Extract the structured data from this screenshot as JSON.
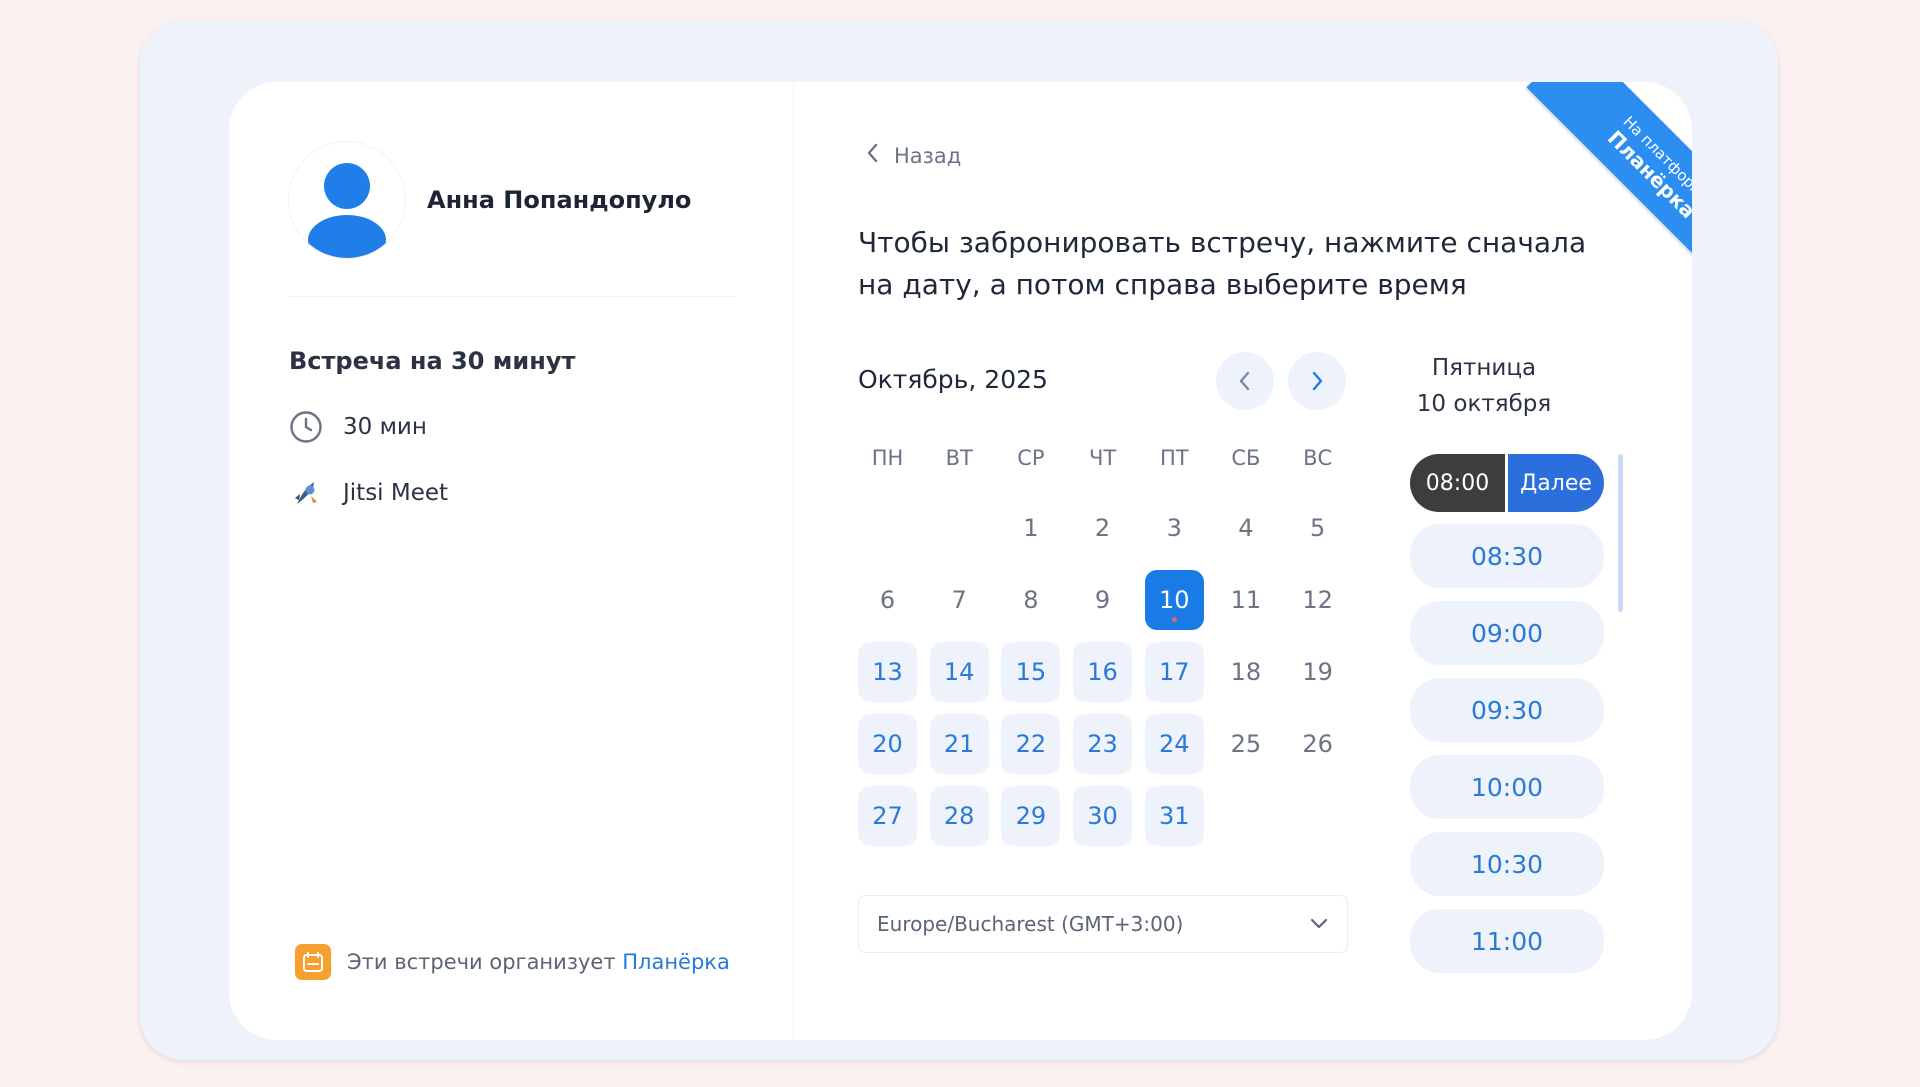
{
  "profile": {
    "name": "Анна Попандопуло"
  },
  "event": {
    "title": "Встреча на 30 минут",
    "duration": "30 мин",
    "location": "Jitsi Meet"
  },
  "organizer": {
    "text": "Эти встречи организует",
    "link": "Планёрка"
  },
  "booking": {
    "back_label": "Назад",
    "instruction": "Чтобы забронировать встречу, нажмите сначала на дату, а потом справа выберите время"
  },
  "calendar": {
    "month_label": "Октябрь, 2025",
    "weekdays": [
      "ПН",
      "ВТ",
      "СР",
      "ЧТ",
      "ПТ",
      "СБ",
      "ВС"
    ],
    "leading_empty": 2,
    "days": [
      {
        "n": "1",
        "state": "unavailable"
      },
      {
        "n": "2",
        "state": "unavailable"
      },
      {
        "n": "3",
        "state": "unavailable"
      },
      {
        "n": "4",
        "state": "unavailable"
      },
      {
        "n": "5",
        "state": "unavailable"
      },
      {
        "n": "6",
        "state": "unavailable"
      },
      {
        "n": "7",
        "state": "unavailable"
      },
      {
        "n": "8",
        "state": "unavailable"
      },
      {
        "n": "9",
        "state": "unavailable"
      },
      {
        "n": "10",
        "state": "selected"
      },
      {
        "n": "11",
        "state": "unavailable"
      },
      {
        "n": "12",
        "state": "unavailable"
      },
      {
        "n": "13",
        "state": "available"
      },
      {
        "n": "14",
        "state": "available"
      },
      {
        "n": "15",
        "state": "available"
      },
      {
        "n": "16",
        "state": "available"
      },
      {
        "n": "17",
        "state": "available"
      },
      {
        "n": "18",
        "state": "unavailable"
      },
      {
        "n": "19",
        "state": "unavailable"
      },
      {
        "n": "20",
        "state": "available"
      },
      {
        "n": "21",
        "state": "available"
      },
      {
        "n": "22",
        "state": "available"
      },
      {
        "n": "23",
        "state": "available"
      },
      {
        "n": "24",
        "state": "available"
      },
      {
        "n": "25",
        "state": "unavailable"
      },
      {
        "n": "26",
        "state": "unavailable"
      },
      {
        "n": "27",
        "state": "available"
      },
      {
        "n": "28",
        "state": "available"
      },
      {
        "n": "29",
        "state": "available"
      },
      {
        "n": "30",
        "state": "available"
      },
      {
        "n": "31",
        "state": "available"
      }
    ],
    "timezone": "Europe/Bucharest (GMT+3:00)"
  },
  "schedule": {
    "weekday": "Пятница",
    "date": "10 октября",
    "selected_time": "08:00",
    "next_label": "Далее",
    "times": [
      "08:30",
      "09:00",
      "09:30",
      "10:00",
      "10:30",
      "11:00"
    ]
  },
  "ribbon": {
    "small": "На платформе",
    "big": "Планёрка"
  },
  "colors": {
    "accent": "#1a7be6",
    "next_button": "#2a6fdb",
    "available_bg": "#eef3fb",
    "ribbon": "#2b8ef0",
    "organizer_icon": "#f5a030"
  }
}
